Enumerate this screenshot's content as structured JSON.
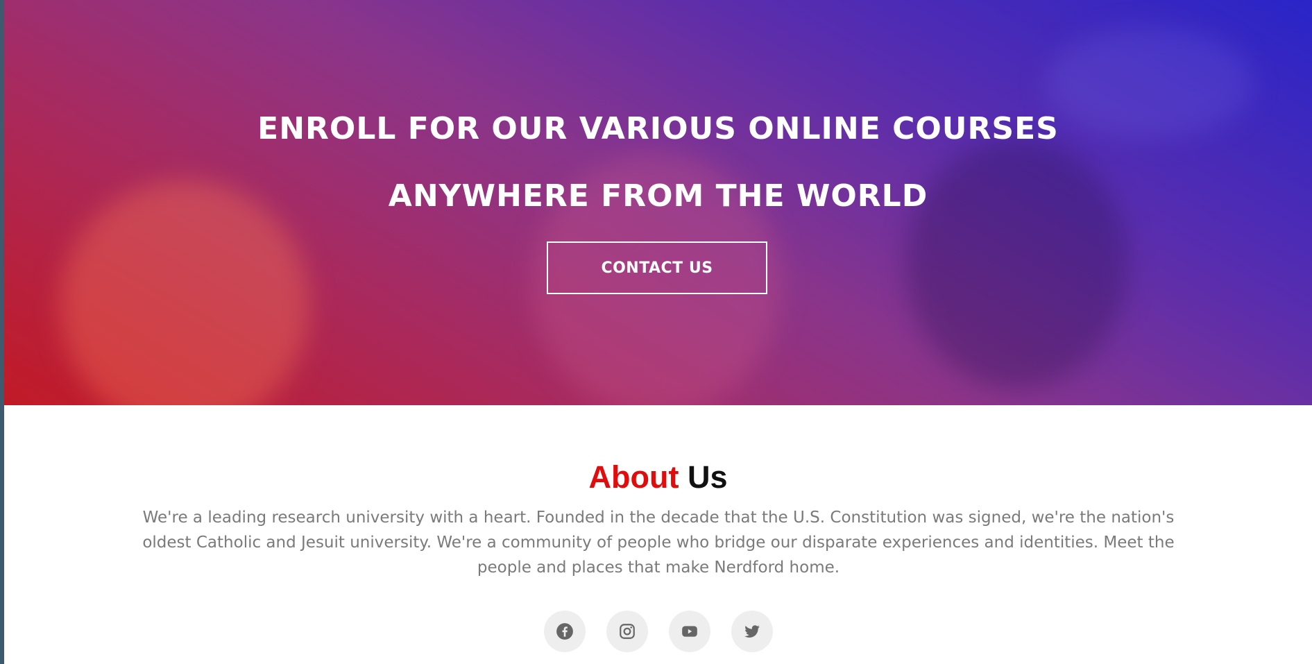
{
  "hero": {
    "title_line1": "ENROLL FOR OUR VARIOUS ONLINE COURSES",
    "title_line2": "ANYWHERE FROM THE WORLD",
    "contact_button": "CONTACT US"
  },
  "about": {
    "title_accent": "About",
    "title_rest": "Us",
    "description": "We're a leading research university with a heart. Founded in the decade that the U.S. Constitution was signed, we're the nation's oldest Catholic and Jesuit university. We're a community of people who bridge our disparate experiences and identities. Meet the people and places that make Nerdford home.",
    "accent_color": "#e10d0d"
  },
  "socials": [
    {
      "icon": "facebook-icon"
    },
    {
      "icon": "instagram-icon"
    },
    {
      "icon": "youtube-icon"
    },
    {
      "icon": "twitter-icon"
    }
  ]
}
